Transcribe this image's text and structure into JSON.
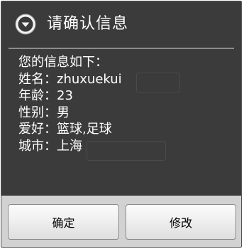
{
  "dialog": {
    "title": "请确认信息",
    "title_icon": "chevron-down-circle-icon",
    "lines": [
      "您的信息如下：",
      "姓名：zhuxuekui",
      "年龄：23",
      "性别：男",
      "爱好：篮球,足球",
      "城市：上海"
    ],
    "buttons": {
      "confirm_label": "确定",
      "modify_label": "修改"
    }
  },
  "colors": {
    "dialog_background": "#3b3b3b",
    "title_text": "#ffffff",
    "body_text": "#ffffff",
    "button_bar": "#d2d2d2",
    "button_text": "#000000"
  }
}
